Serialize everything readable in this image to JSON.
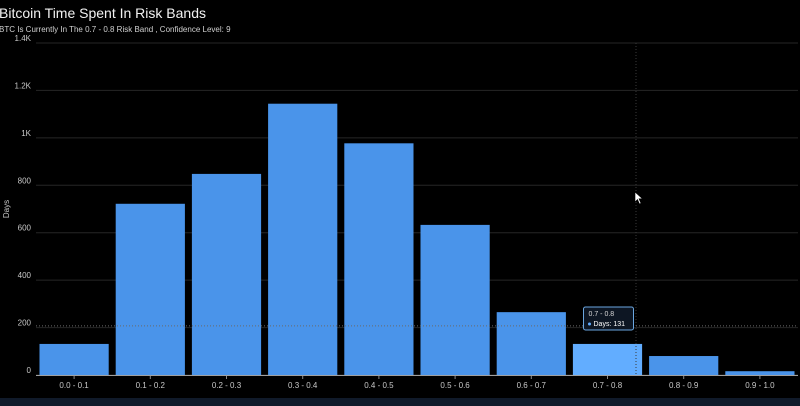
{
  "title": "Bitcoin Time Spent In Risk Bands",
  "subtitle": "BTC Is Currently In The 0.7 - 0.8 Risk Band , Confidence Level: 9",
  "chart_data": {
    "type": "bar",
    "title": "Bitcoin Time Spent In Risk Bands",
    "subtitle": "BTC Is Currently In The 0.7 - 0.8 Risk Band , Confidence Level: 9",
    "xlabel": "",
    "ylabel": "Days",
    "ylim": [
      0,
      1400
    ],
    "yticks": [
      0,
      200,
      400,
      600,
      800,
      1000,
      1200,
      1400
    ],
    "ytick_labels": [
      "0",
      "200",
      "400",
      "600",
      "800",
      "1K",
      "1.2K",
      "1.4K"
    ],
    "categories": [
      "0.0 - 0.1",
      "0.1 - 0.2",
      "0.2 - 0.3",
      "0.3 - 0.4",
      "0.4 - 0.5",
      "0.5 - 0.6",
      "0.6 - 0.7",
      "0.7 - 0.8",
      "0.8 - 0.9",
      "0.9 - 1.0"
    ],
    "values": [
      131,
      722,
      848,
      1144,
      977,
      633,
      265,
      131,
      80,
      16
    ],
    "highlighted_category": "0.7 - 0.8",
    "grid": true,
    "legend": "none",
    "colors": {
      "bar": "#4a94ea",
      "bar_highlight": "#62adff",
      "grid": "#262626",
      "axis_text": "#c8c8c8",
      "background": "#000000"
    },
    "tooltip": {
      "title": "0.7 - 0.8",
      "label": "Days",
      "value": 131
    }
  }
}
